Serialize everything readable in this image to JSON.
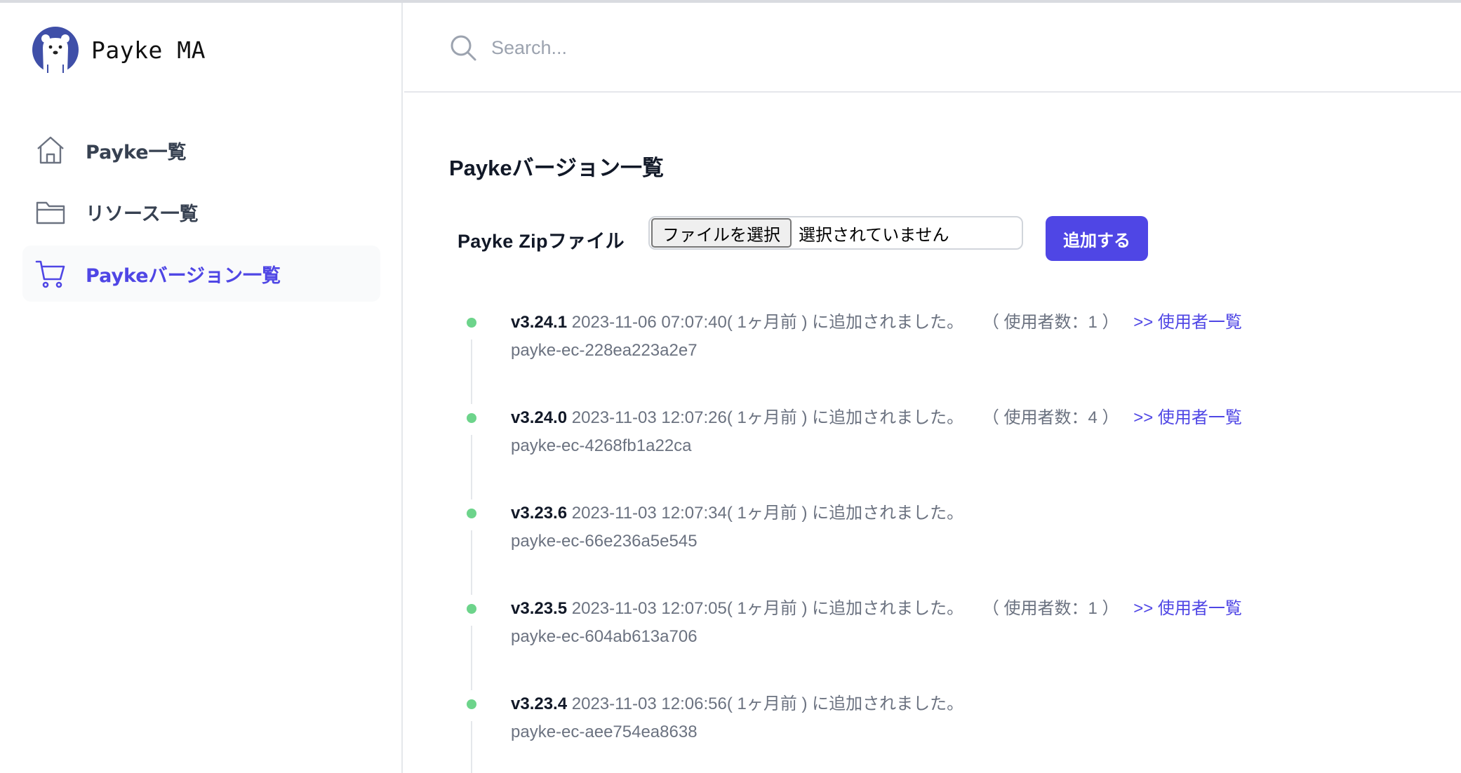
{
  "app": {
    "name": "Payke MA"
  },
  "sidebar": {
    "items": [
      {
        "label": "Payke一覧",
        "icon": "home-icon",
        "active": false
      },
      {
        "label": "リソース一覧",
        "icon": "folder-icon",
        "active": false
      },
      {
        "label": "Paykeバージョン一覧",
        "icon": "cart-icon",
        "active": true
      }
    ]
  },
  "header": {
    "search_placeholder": "Search..."
  },
  "main": {
    "title": "Paykeバージョン一覧",
    "upload": {
      "label": "Payke Zipファイル",
      "file_button": "ファイルを選択",
      "file_status": "選択されていません",
      "submit": "追加する"
    },
    "versions": [
      {
        "version": "v3.24.1",
        "meta": "2023-11-06 07:07:40( 1ヶ月前 ) に追加されました。",
        "users": "（ 使用者数：1 ）",
        "link": ">> 使用者一覧",
        "code": "payke-ec-228ea223a2e7"
      },
      {
        "version": "v3.24.0",
        "meta": "2023-11-03 12:07:26( 1ヶ月前 ) に追加されました。",
        "users": "（ 使用者数：4 ）",
        "link": ">> 使用者一覧",
        "code": "payke-ec-4268fb1a22ca"
      },
      {
        "version": "v3.23.6",
        "meta": "2023-11-03 12:07:34( 1ヶ月前 ) に追加されました。",
        "users": "",
        "link": "",
        "code": "payke-ec-66e236a5e545"
      },
      {
        "version": "v3.23.5",
        "meta": "2023-11-03 12:07:05( 1ヶ月前 ) に追加されました。",
        "users": "（ 使用者数：1 ）",
        "link": ">> 使用者一覧",
        "code": "payke-ec-604ab613a706"
      },
      {
        "version": "v3.23.4",
        "meta": "2023-11-03 12:06:56( 1ヶ月前 ) に追加されました。",
        "users": "",
        "link": "",
        "code": "payke-ec-aee754ea8638"
      }
    ]
  },
  "colors": {
    "accent": "#4f46e5",
    "dot": "#6dd48b",
    "logo": "#3f4fa8"
  }
}
